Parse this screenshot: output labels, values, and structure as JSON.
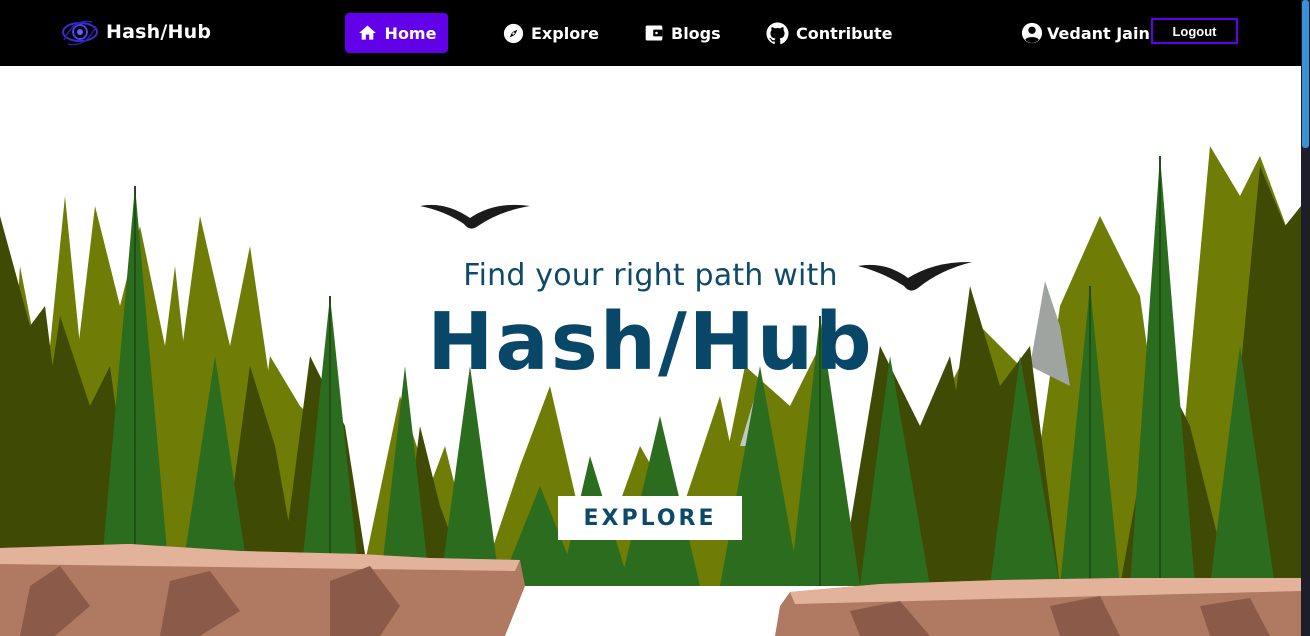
{
  "brand": {
    "name": "Hash/Hub",
    "logo_icon": "eye-swirl-logo-icon"
  },
  "nav": {
    "items": [
      {
        "label": "Home",
        "icon": "home-icon",
        "active": true
      },
      {
        "label": "Explore",
        "icon": "compass-icon",
        "active": false
      },
      {
        "label": "Blogs",
        "icon": "wallet-icon",
        "active": false
      },
      {
        "label": "Contribute",
        "icon": "github-icon",
        "active": false
      }
    ]
  },
  "user": {
    "name": "Vedant Jain",
    "icon": "account-circle-icon",
    "logout_label": "Logout"
  },
  "hero": {
    "tagline": "Find your right path with",
    "title": "Hash/Hub",
    "cta_label": "EXPLORE"
  },
  "colors": {
    "navbar_bg": "#000000",
    "accent": "#6200ea",
    "title_color": "#084767",
    "tree_light": "#6f7d06",
    "tree_dark": "#3f4a05",
    "tree_mid": "#2c6c1e",
    "cliff": "#b07a62"
  }
}
